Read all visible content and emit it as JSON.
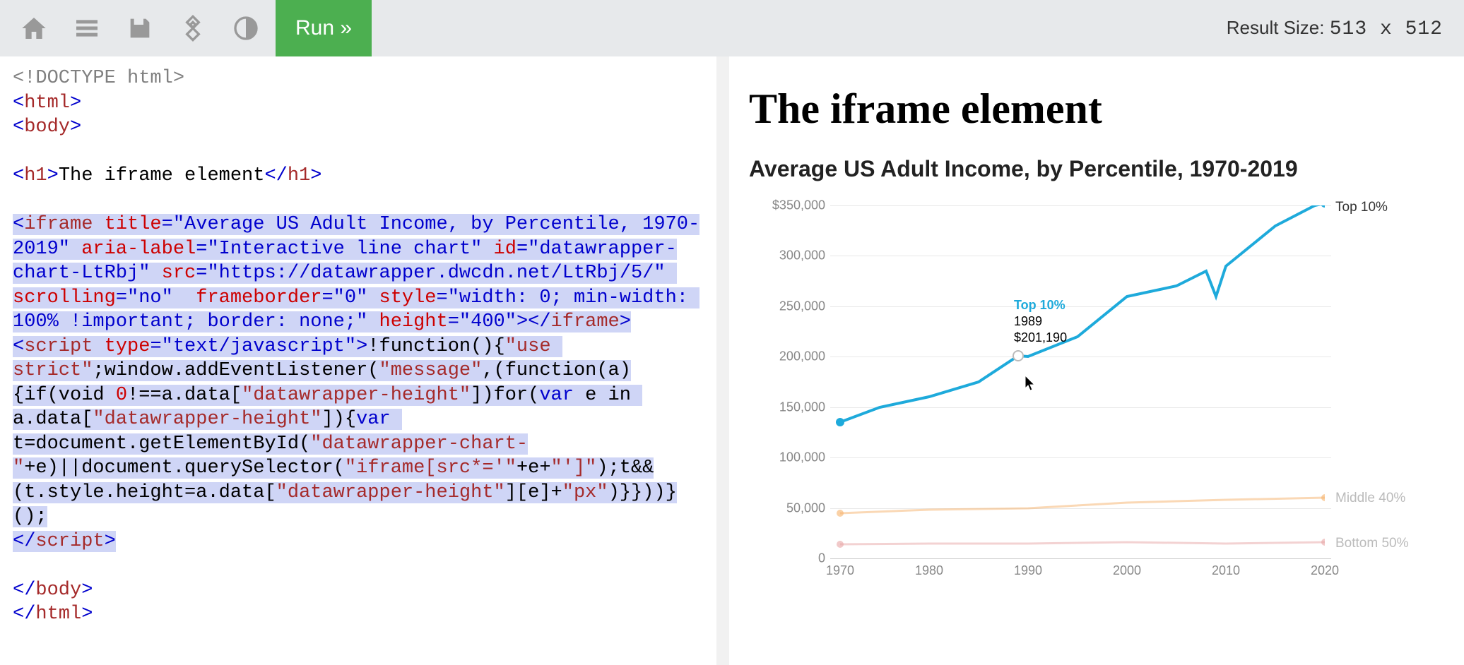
{
  "toolbar": {
    "run_label": "Run »",
    "result_size_label": "Result Size:",
    "result_w": "513",
    "result_h": "512"
  },
  "editor": {
    "doctype": "<!DOCTYPE html>",
    "html_open": "html",
    "body_open": "body",
    "h1_tag": "h1",
    "h1_text": "The iframe element",
    "iframe_tag": "iframe",
    "iframe_attrs": {
      "title": "Average US Adult Income, by Percentile, 1970-2019",
      "aria_label": "Interactive line chart",
      "id": "datawrapper-chart-LtRbj",
      "src": "https://datawrapper.dwcdn.net/LtRbj/5/",
      "scrolling": "no",
      "frameborder": "0",
      "style": "width: 0; min-width: 100% !important; border: none;",
      "height": "400"
    },
    "script_tag": "script",
    "script_type": "text/javascript",
    "js_parts": {
      "p1": "!function(){",
      "use_strict": "\"use strict\"",
      "p2": ";window.addEventListener(",
      "msg": "\"message\"",
      "p3": ",(function(a){if(void ",
      "zero": "0",
      "p4": "!==a.data[",
      "dw1": "\"datawrapper-height\"",
      "p5": "])for(var e in a.data[",
      "dw2": "\"datawrapper-height\"",
      "p6": "]){var t=document.getElementById(",
      "dwc": "\"datawrapper-chart-\"",
      "p7": "+e)||document.querySelector(",
      "ifs": "\"iframe[src*='\"",
      "p8": "+e+",
      "ife": "\"']\"",
      "p9": ");t&&(t.style.height=a.data[",
      "dw3": "\"datawrapper-height\"",
      "p10": "][e]+",
      "px": "\"px\"",
      "p11": ")}}))}();"
    }
  },
  "preview": {
    "h1": "The iframe element",
    "chart_title": "Average US Adult Income, by Percentile, 1970-2019",
    "tooltip": {
      "series": "Top 10%",
      "year": "1989",
      "value": "$201,190"
    },
    "labels": {
      "top10": "Top 10%",
      "mid40": "Middle 40%",
      "bot50": "Bottom 50%"
    }
  },
  "chart_data": {
    "type": "line",
    "title": "Average US Adult Income, by Percentile, 1970-2019",
    "xlabel": "",
    "ylabel": "",
    "xlim": [
      1970,
      2020
    ],
    "ylim": [
      0,
      350000
    ],
    "y_ticks": [
      "$350,000",
      "300,000",
      "250,000",
      "200,000",
      "150,000",
      "100,000",
      "50,000",
      "0"
    ],
    "x_ticks": [
      "1970",
      "1980",
      "1990",
      "2000",
      "2010",
      "2020"
    ],
    "series": [
      {
        "name": "Top 10%",
        "color": "#1eaadb",
        "x": [
          1971,
          1975,
          1980,
          1985,
          1989,
          1990,
          1995,
          2000,
          2005,
          2008,
          2009,
          2010,
          2015,
          2019,
          2020
        ],
        "y": [
          135000,
          150000,
          160000,
          175000,
          201190,
          200000,
          220000,
          260000,
          270000,
          285000,
          260000,
          290000,
          330000,
          350000,
          352000
        ]
      },
      {
        "name": "Middle 40%",
        "color": "#f6b26b",
        "x": [
          1971,
          1980,
          1990,
          2000,
          2010,
          2020
        ],
        "y": [
          45000,
          48000,
          50000,
          55000,
          58000,
          60000
        ]
      },
      {
        "name": "Bottom 50%",
        "color": "#e8a5a5",
        "x": [
          1971,
          1980,
          1990,
          2000,
          2010,
          2020
        ],
        "y": [
          14000,
          15000,
          15000,
          16000,
          15000,
          16000
        ]
      }
    ],
    "highlight": {
      "series": "Top 10%",
      "x": 1989,
      "y": 201190
    }
  }
}
